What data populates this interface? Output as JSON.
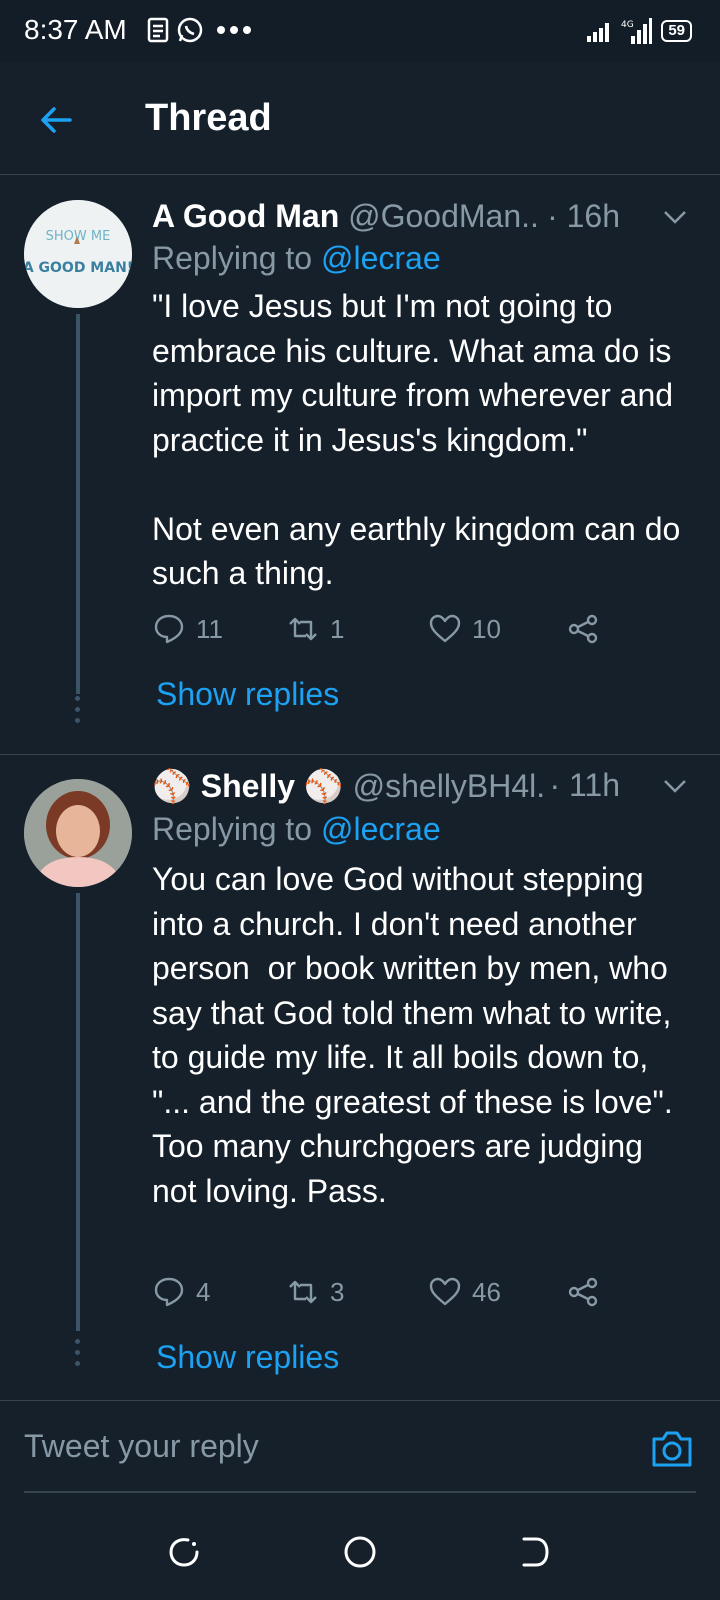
{
  "status_bar": {
    "time": "8:37 AM",
    "battery": "59"
  },
  "header": {
    "title": "Thread"
  },
  "tweets": [
    {
      "name": "A Good Man",
      "handle": "@GoodMan...",
      "time": "· 16h",
      "reply_prefix": "Replying to ",
      "reply_to": "@lecrae",
      "text": "\"I love Jesus but I'm not going to embrace his culture. What ama do is import my culture from wherever and practice it in Jesus's kingdom.\"\n\nNot even any earthly kingdom can do such a thing.",
      "avatar_text": {
        "top": "SHOW ME",
        "bottom": "A GOOD MAN!"
      },
      "replies": "11",
      "retweets": "1",
      "likes": "10",
      "show_replies": "Show replies"
    },
    {
      "name": "Shelly",
      "name_emoji": "⚾",
      "handle": "@shellyBH4l...",
      "time": "· 11h",
      "reply_prefix": "Replying to ",
      "reply_to": "@lecrae",
      "text": "You can love God without stepping into a church. I don't need another person  or book written by men, who say that God told them what to write, to guide my life. It all boils down to, \"... and the greatest of these is love\". Too many churchgoers are judging not loving. Pass.",
      "replies": "4",
      "retweets": "3",
      "likes": "46",
      "show_replies": "Show replies"
    }
  ],
  "reply_box": {
    "placeholder": "Tweet your reply"
  },
  "icons": {
    "back": "arrow-left-icon",
    "reply": "comment-icon",
    "retweet": "retweet-icon",
    "like": "heart-icon",
    "share": "share-icon",
    "camera": "camera-icon"
  },
  "colors": {
    "background": "#15202b",
    "accent": "#1da1f2",
    "secondary_text": "#8899a6"
  }
}
